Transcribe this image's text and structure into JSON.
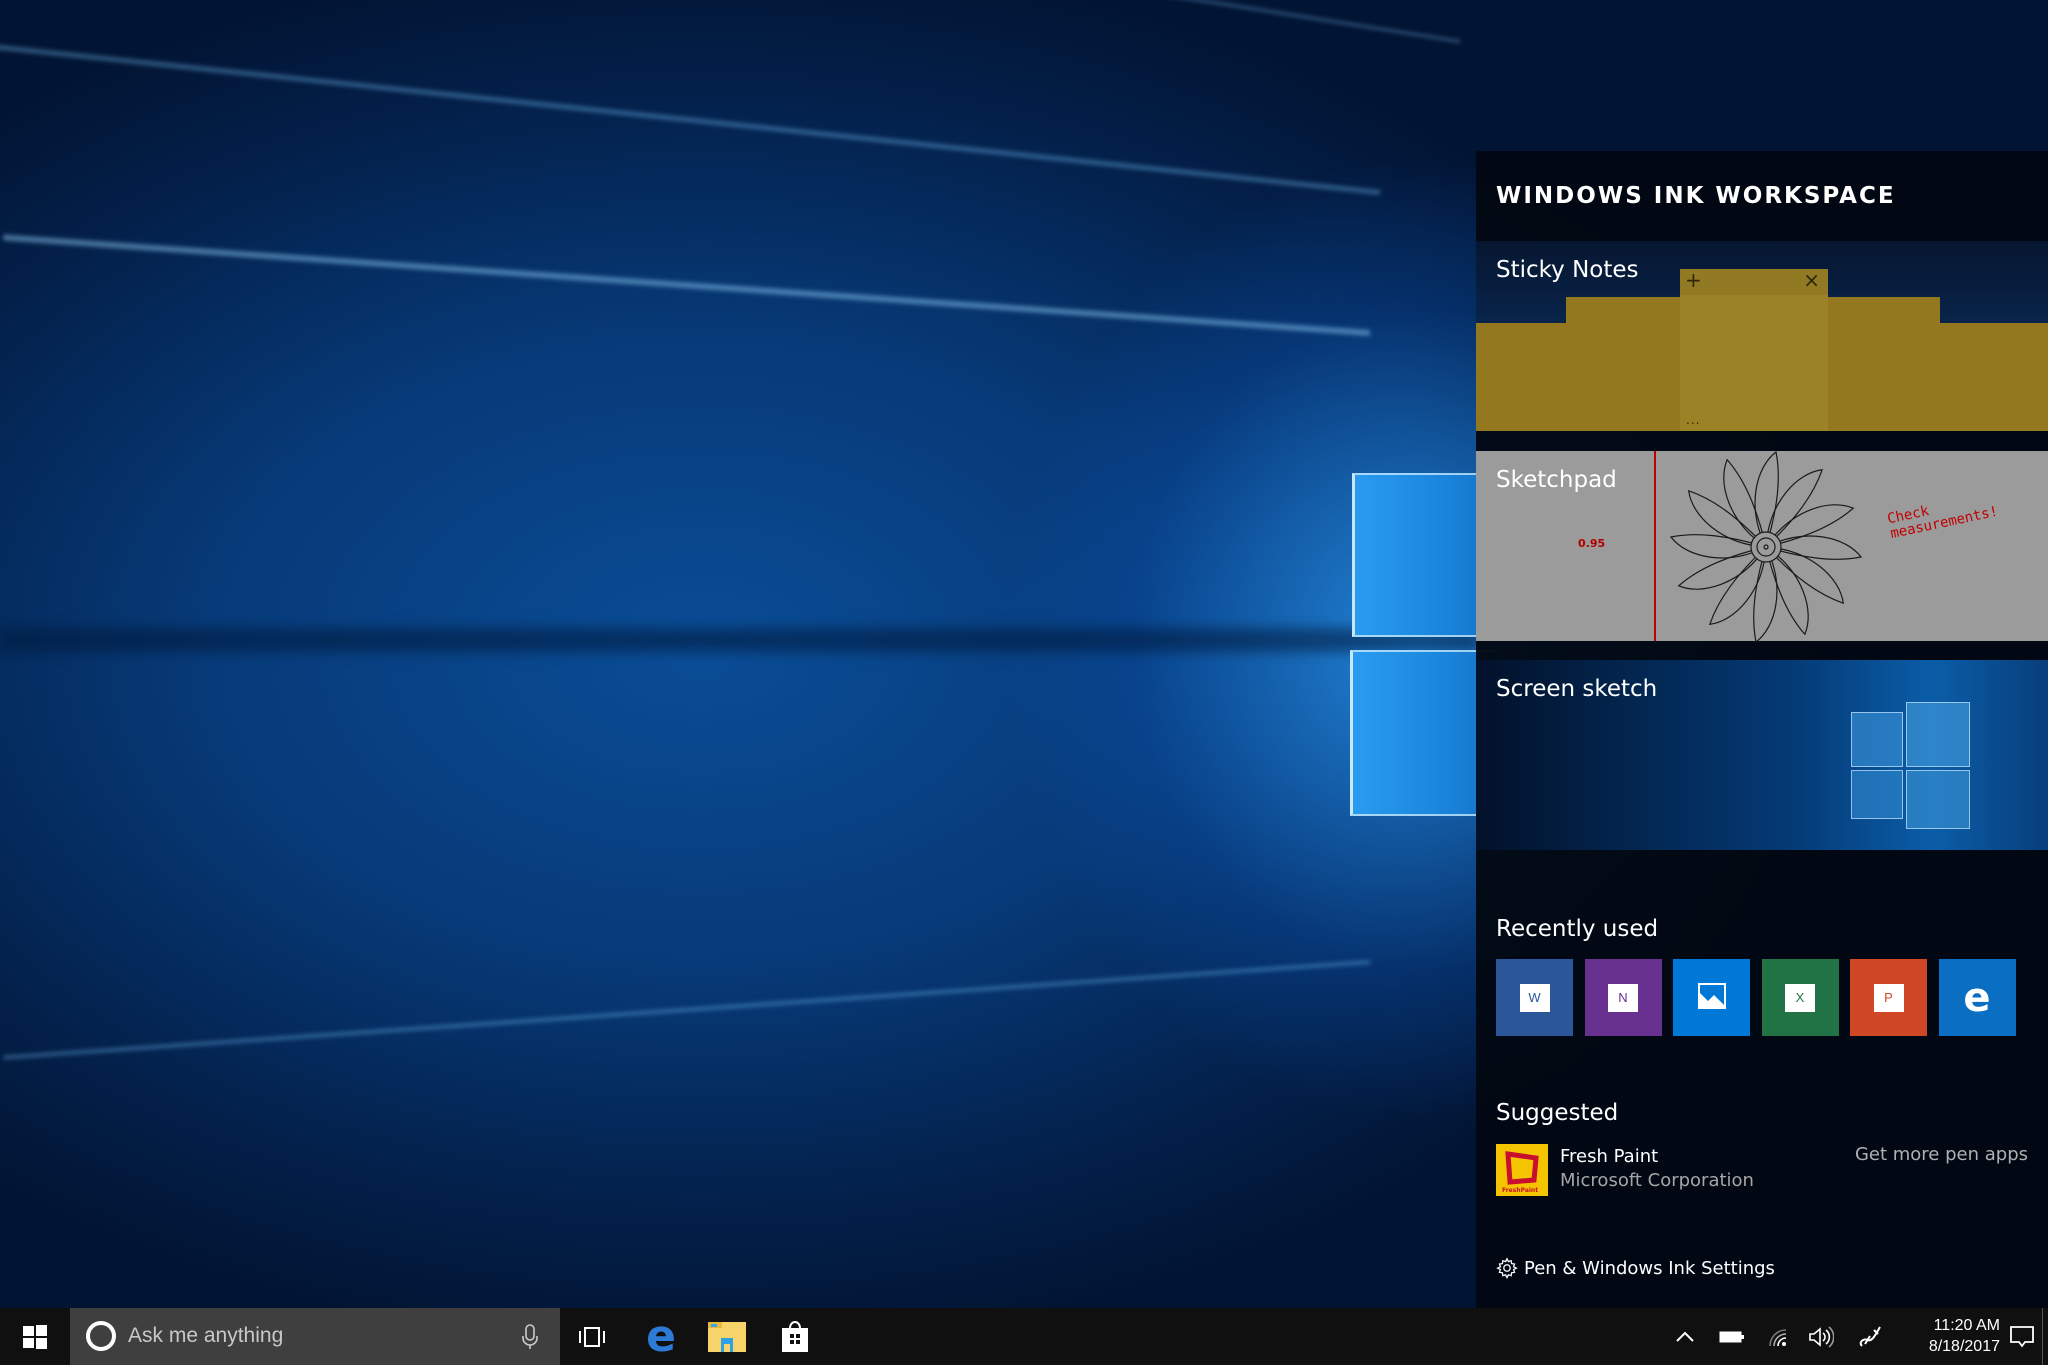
{
  "panel": {
    "title": "WINDOWS INK WORKSPACE",
    "tiles": [
      {
        "label": "Sticky Notes"
      },
      {
        "label": "Sketchpad",
        "sketch_number": "0.95",
        "sketch_annotation_line1": "Check",
        "sketch_annotation_line2": "measurements!"
      },
      {
        "label": "Screen sketch"
      }
    ],
    "sticky_note": {
      "add_glyph": "+",
      "close_glyph": "×",
      "menu_glyph": "..."
    },
    "recently_used": {
      "heading": "Recently used",
      "apps": [
        {
          "name": "Word",
          "icon": "word-icon",
          "glyph": "W",
          "color": "#2b579a"
        },
        {
          "name": "OneNote",
          "icon": "onenote-icon",
          "glyph": "N",
          "color": "#68308f"
        },
        {
          "name": "Photos",
          "icon": "photos-icon",
          "glyph": "",
          "color": "#0078d7"
        },
        {
          "name": "Excel",
          "icon": "excel-icon",
          "glyph": "X",
          "color": "#217346"
        },
        {
          "name": "PowerPoint",
          "icon": "powerpoint-icon",
          "glyph": "P",
          "color": "#d04727"
        },
        {
          "name": "Microsoft Edge",
          "icon": "edge-icon",
          "glyph": "e",
          "color": "#0a6fc2"
        }
      ]
    },
    "suggested": {
      "heading": "Suggested",
      "app_name": "Fresh Paint",
      "publisher": "Microsoft Corporation",
      "icon_caption": "FreshPaint",
      "more_link": "Get more pen apps"
    },
    "settings_link": "Pen & Windows Ink Settings"
  },
  "taskbar": {
    "search_placeholder": "Ask me anything",
    "pinned": [
      "Task View",
      "Microsoft Edge",
      "File Explorer",
      "Store"
    ],
    "clock_time": "11:20 AM",
    "clock_date": "8/18/2017",
    "tray": [
      "show-hidden-icons",
      "battery",
      "wifi",
      "volume",
      "windows-ink",
      "action-center"
    ]
  }
}
